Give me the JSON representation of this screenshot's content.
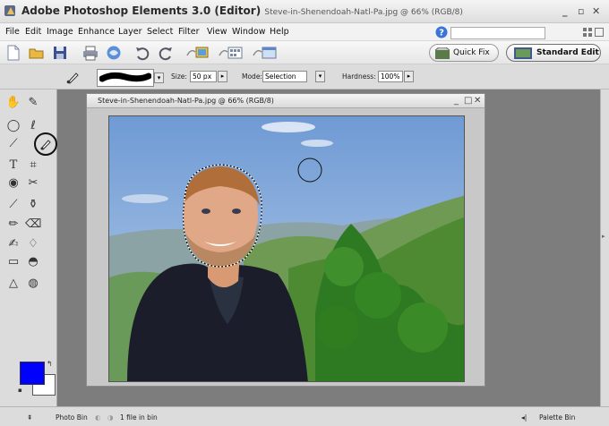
{
  "titlebar": {
    "app_title": "Adobe Photoshop Elements 3.0 (Editor)",
    "document": "Steve-in-Shenendoah-Natl-Pa.jpg @ 66% (RGB/8)",
    "minimize": "_",
    "restore": "▫",
    "close": "✕"
  },
  "menu": [
    "File",
    "Edit",
    "Image",
    "Enhance",
    "Layer",
    "Select",
    "Filter",
    "View",
    "Window",
    "Help"
  ],
  "help_search": {
    "value": ""
  },
  "modes": {
    "quick_fix": "Quick Fix",
    "standard_edit": "Standard Edit"
  },
  "options_bar": {
    "size_label": "Size:",
    "size_value": "50 px",
    "mode_label": "Mode:",
    "mode_value": "Selection",
    "hardness_label": "Hardness:",
    "hardness_value": "100%"
  },
  "document_window": {
    "title": "Steve-in-Shenendoah-Natl-Pa.jpg @ 66% (RGB/8)",
    "minimize": "_",
    "maximize": "□",
    "close": "✕"
  },
  "colors": {
    "foreground": "#0000ff",
    "background": "#ffffff"
  },
  "statusbar": {
    "photo_bin": "Photo Bin",
    "file_count": "1 file in bin",
    "palette_bin": "Palette Bin"
  }
}
